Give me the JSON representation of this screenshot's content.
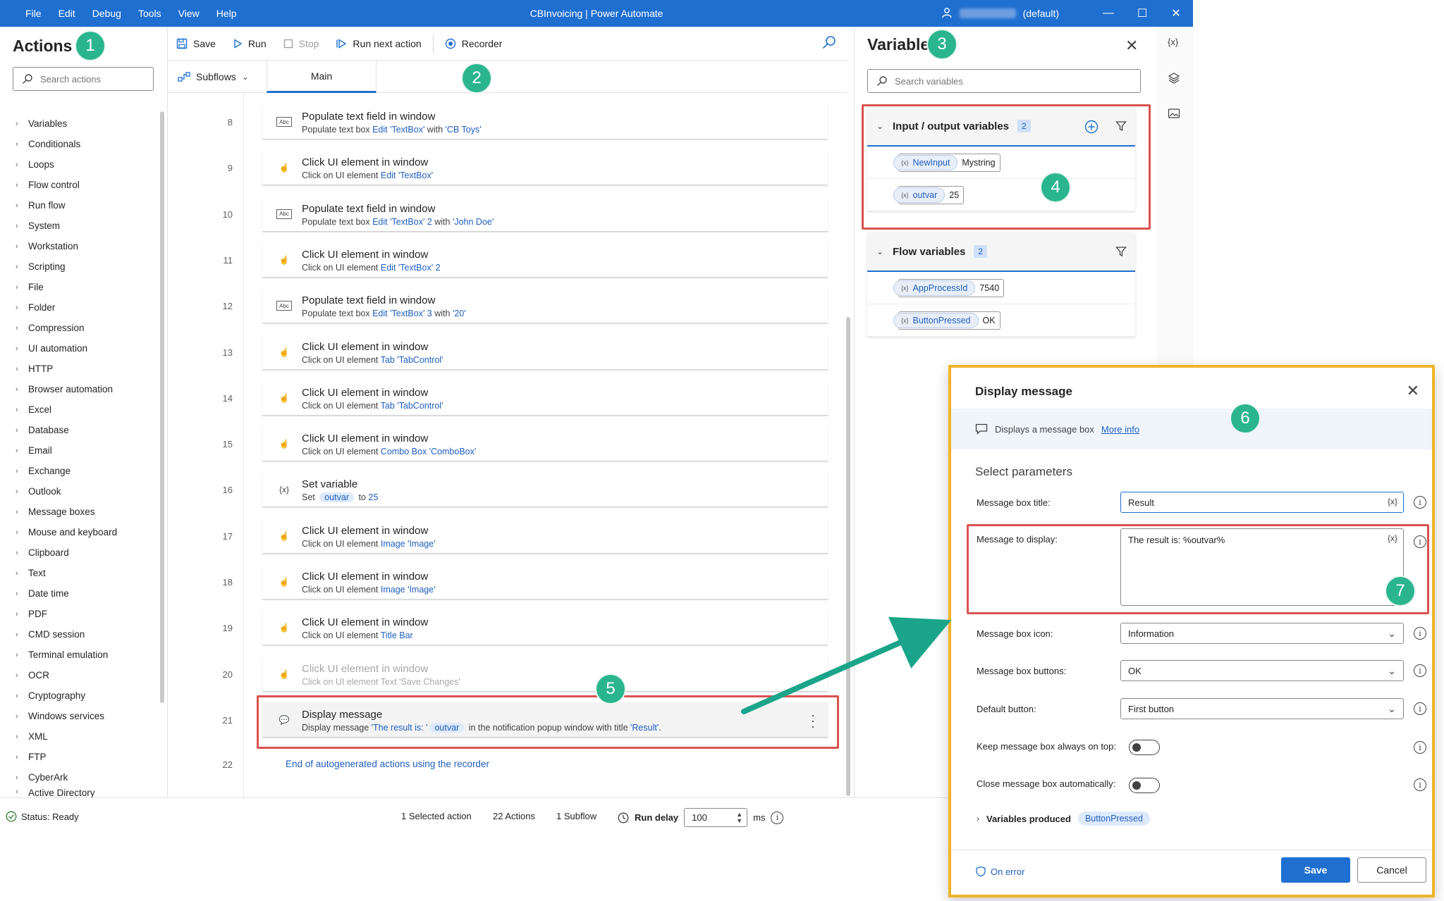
{
  "titlebar": {
    "menu": [
      "File",
      "Edit",
      "Debug",
      "Tools",
      "View",
      "Help"
    ],
    "title": "CBInvoicing | Power Automate",
    "environment": "(default)",
    "min": "—",
    "max": "☐",
    "close": "✕"
  },
  "actions_pane": {
    "title": "Actions",
    "search_placeholder": "Search actions",
    "categories": [
      "Variables",
      "Conditionals",
      "Loops",
      "Flow control",
      "Run flow",
      "System",
      "Workstation",
      "Scripting",
      "File",
      "Folder",
      "Compression",
      "UI automation",
      "HTTP",
      "Browser automation",
      "Excel",
      "Database",
      "Email",
      "Exchange",
      "Outlook",
      "Message boxes",
      "Mouse and keyboard",
      "Clipboard",
      "Text",
      "Date time",
      "PDF",
      "CMD session",
      "Terminal emulation",
      "OCR",
      "Cryptography",
      "Windows services",
      "XML",
      "FTP",
      "CyberArk",
      "Active Directory"
    ]
  },
  "toolbar": {
    "save": "Save",
    "run": "Run",
    "stop": "Stop",
    "run_next": "Run next action",
    "recorder": "Recorder"
  },
  "tabs": {
    "subflows": "Subflows",
    "main": "Main"
  },
  "steps": [
    {
      "num": "8",
      "icon": "Abc",
      "title": "Populate text field in window",
      "pre": "Populate text box ",
      "hl1": "Edit 'TextBox'",
      "mid": " with ",
      "hl2": "'CB Toys'",
      "post": ""
    },
    {
      "num": "9",
      "icon": "☝",
      "title": "Click UI element in window",
      "pre": "Click on UI element ",
      "hl1": "Edit 'TextBox'",
      "mid": "",
      "hl2": "",
      "post": ""
    },
    {
      "num": "10",
      "icon": "Abc",
      "title": "Populate text field in window",
      "pre": "Populate text box ",
      "hl1": "Edit 'TextBox' 2",
      "mid": " with ",
      "hl2": "'John Doe'",
      "post": ""
    },
    {
      "num": "11",
      "icon": "☝",
      "title": "Click UI element in window",
      "pre": "Click on UI element ",
      "hl1": "Edit 'TextBox' 2",
      "mid": "",
      "hl2": "",
      "post": ""
    },
    {
      "num": "12",
      "icon": "Abc",
      "title": "Populate text field in window",
      "pre": "Populate text box ",
      "hl1": "Edit 'TextBox' 3",
      "mid": " with ",
      "hl2": "'20'",
      "post": ""
    },
    {
      "num": "13",
      "icon": "☝",
      "title": "Click UI element in window",
      "pre": "Click on UI element ",
      "hl1": "Tab 'TabControl'",
      "mid": "",
      "hl2": "",
      "post": ""
    },
    {
      "num": "14",
      "icon": "☝",
      "title": "Click UI element in window",
      "pre": "Click on UI element ",
      "hl1": "Tab 'TabControl'",
      "mid": "",
      "hl2": "",
      "post": ""
    },
    {
      "num": "15",
      "icon": "☝",
      "title": "Click UI element in window",
      "pre": "Click on UI element ",
      "hl1": "Combo Box 'ComboBox'",
      "mid": "",
      "hl2": "",
      "post": ""
    },
    {
      "num": "16",
      "icon": "{x}",
      "title": "Set variable",
      "pre": "Set ",
      "pill": "outvar",
      "mid": " to ",
      "hl2": "25",
      "post": ""
    },
    {
      "num": "17",
      "icon": "☝",
      "title": "Click UI element in window",
      "pre": "Click on UI element ",
      "hl1": "Image 'Image'",
      "mid": "",
      "hl2": "",
      "post": ""
    },
    {
      "num": "18",
      "icon": "☝",
      "title": "Click UI element in window",
      "pre": "Click on UI element ",
      "hl1": "Image 'Image'",
      "mid": "",
      "hl2": "",
      "post": ""
    },
    {
      "num": "19",
      "icon": "☝",
      "title": "Click UI element in window",
      "pre": "Click on UI element ",
      "hl1": "Title Bar",
      "mid": "",
      "hl2": "",
      "post": ""
    },
    {
      "num": "20",
      "icon": "☝",
      "title": "Click UI element in window",
      "pre": "Click on UI element ",
      "hl1": "Text 'Save Changes'",
      "mid": "",
      "hl2": "",
      "post": "",
      "dim": true
    },
    {
      "num": "21",
      "icon": "💬",
      "title": "Display message",
      "pre": "Display message ",
      "hl1": "'The result is: '",
      "pill": "outvar",
      "mid": " in the notification popup window with title ",
      "hl2": "'Result'",
      "post": ".",
      "selected": true
    }
  ],
  "end_step": {
    "num": "22",
    "text": "End of autogenerated actions using the recorder"
  },
  "status": {
    "ready": "Status: Ready",
    "selected": "1 Selected action",
    "actions": "22 Actions",
    "subflow": "1 Subflow",
    "run_delay_label": "Run delay",
    "run_delay_value": "100",
    "unit": "ms"
  },
  "variables_pane": {
    "title": "Variables",
    "search_placeholder": "Search variables",
    "io_group": {
      "title": "Input / output variables",
      "count": "2",
      "items": [
        {
          "name": "NewInput",
          "value": "Mystring"
        },
        {
          "name": "outvar",
          "value": "25"
        }
      ]
    },
    "flow_group": {
      "title": "Flow variables",
      "count": "2",
      "items": [
        {
          "name": "AppProcessId",
          "value": "7540"
        },
        {
          "name": "ButtonPressed",
          "value": "OK"
        }
      ]
    }
  },
  "rail": {
    "vars": "{x}"
  },
  "dialog": {
    "title": "Display message",
    "info": "Displays a message box",
    "more_info": "More info",
    "section": "Select parameters",
    "fields": {
      "title_label": "Message box title:",
      "title_value": "Result",
      "message_label": "Message to display:",
      "message_value": "The result is: %outvar%",
      "icon_label": "Message box icon:",
      "icon_value": "Information",
      "buttons_label": "Message box buttons:",
      "buttons_value": "OK",
      "default_label": "Default button:",
      "default_value": "First button",
      "ontop_label": "Keep message box always on top:",
      "autoclose_label": "Close message box automatically:"
    },
    "vars_produced_label": "Variables produced",
    "vars_produced_value": "ButtonPressed",
    "on_error": "On error",
    "save": "Save",
    "cancel": "Cancel"
  },
  "callouts": [
    "1",
    "2",
    "3",
    "4",
    "5",
    "6",
    "7"
  ],
  "colors": {
    "titlebar": "#1f6fd1",
    "callout": "#2bb58e",
    "highlight_box": "#d9534f",
    "dialog_border": "#f0b429"
  }
}
